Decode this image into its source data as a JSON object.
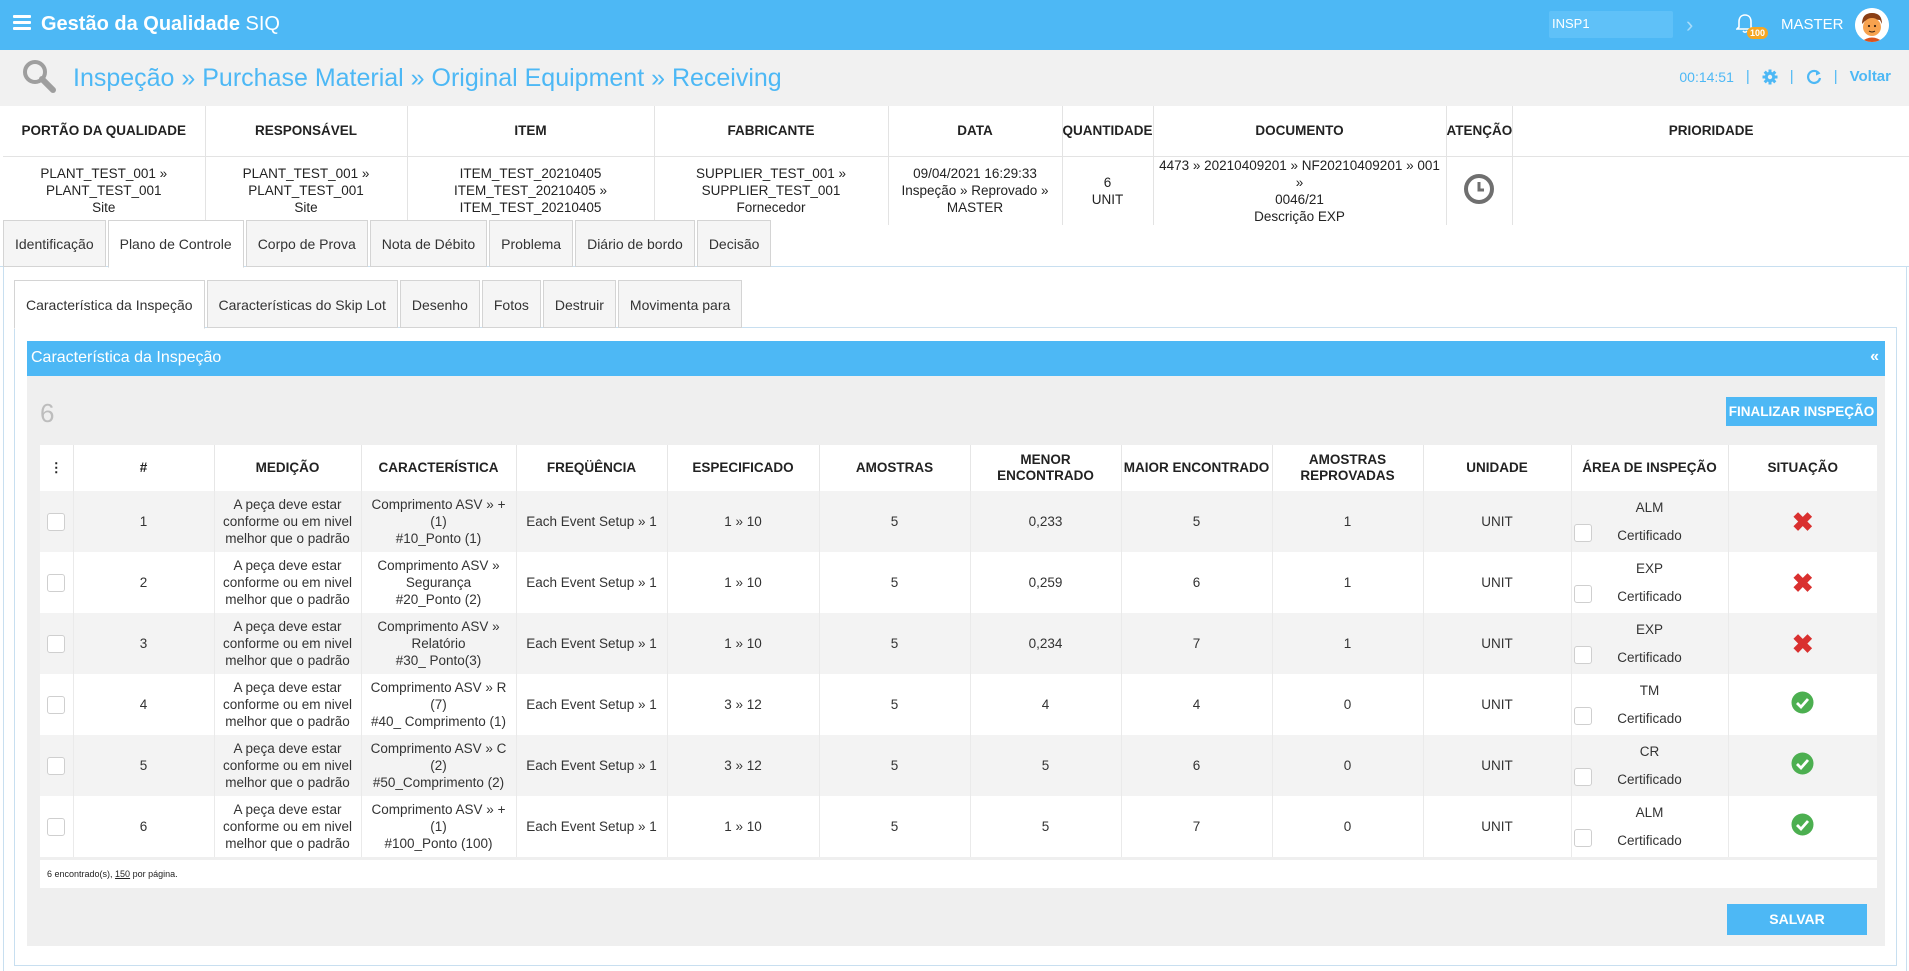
{
  "app": {
    "title_bold": "Gestão da Qualidade",
    "title_suffix": "SIQ"
  },
  "topbar": {
    "inspection_code": "INSP1",
    "notifications_count": "100",
    "user_name": "MASTER"
  },
  "breadcrumb": {
    "text": "Inspeção » Purchase Material » Original Equipment » Receiving",
    "timer": "00:14:51",
    "back_label": "Voltar"
  },
  "header_table": {
    "columns": [
      "PORTÃO DA QUALIDADE",
      "RESPONSÁVEL",
      "ITEM",
      "FABRICANTE",
      "DATA",
      "QUANTIDADE",
      "DOCUMENTO",
      "ATENÇÃO",
      "PRIORIDADE"
    ],
    "values": {
      "portao": [
        "PLANT_TEST_001 »",
        "PLANT_TEST_001",
        "Site"
      ],
      "responsavel": [
        "PLANT_TEST_001 »",
        "PLANT_TEST_001",
        "Site"
      ],
      "item": [
        "ITEM_TEST_20210405",
        "ITEM_TEST_20210405 »",
        "ITEM_TEST_20210405"
      ],
      "fabricante": [
        "SUPPLIER_TEST_001 »",
        "SUPPLIER_TEST_001",
        "Fornecedor"
      ],
      "data": [
        "09/04/2021 16:29:33",
        "Inspeção » Reprovado »",
        "MASTER"
      ],
      "quantidade": [
        "6",
        "UNIT"
      ],
      "documento": [
        "4473 » 20210409201 » NF20210409201 » 001 »",
        "0046/21",
        "Descrição EXP"
      ],
      "atencao_icon": "clock-icon",
      "prioridade": ""
    }
  },
  "tabs_main": [
    "Identificação",
    "Plano de Controle",
    "Corpo de Prova",
    "Nota de Débito",
    "Problema",
    "Diário de bordo",
    "Decisão"
  ],
  "tabs_main_active": 1,
  "tabs_sub": [
    "Característica da Inspeção",
    "Características do Skip Lot",
    "Desenho",
    "Fotos",
    "Destruir",
    "Movimenta para"
  ],
  "tabs_sub_active": 0,
  "panel": {
    "title": "Característica da Inspeção",
    "collapse_label": "«",
    "count": "6",
    "finalize_label": "FINALIZAR INSPEÇÃO",
    "save_label": "SALVAR"
  },
  "grid": {
    "menu_header": "⋮",
    "headers": [
      "#",
      "MEDIÇÃO",
      "CARACTERÍSTICA",
      "FREQÜÊNCIA",
      "ESPECIFICADO",
      "AMOSTRAS",
      "MENOR ENCONTRADO",
      "MAIOR ENCONTRADO",
      "AMOSTRAS REPROVADAS",
      "UNIDADE",
      "ÁREA DE INSPEÇÃO",
      "SITUAÇÃO"
    ],
    "rows": [
      {
        "num": "1",
        "medicao": [
          "A peça deve estar",
          "conforme ou em nivel",
          "melhor que o padrão"
        ],
        "caracteristica": [
          "Comprimento ASV » +",
          "(1)",
          "#10_Ponto (1)"
        ],
        "frequencia": "Each Event Setup » 1",
        "especificado": "1 » 10",
        "amostras": "5",
        "menor": "0,233",
        "maior": "5",
        "reprovadas": "1",
        "unidade": "UNIT",
        "area": "ALM",
        "area_label": "Certificado",
        "status": "reprovado"
      },
      {
        "num": "2",
        "medicao": [
          "A peça deve estar",
          "conforme ou em nivel",
          "melhor que o padrão"
        ],
        "caracteristica": [
          "Comprimento ASV »",
          "Segurança",
          "#20_Ponto (2)"
        ],
        "frequencia": "Each Event Setup » 1",
        "especificado": "1 » 10",
        "amostras": "5",
        "menor": "0,259",
        "maior": "6",
        "reprovadas": "1",
        "unidade": "UNIT",
        "area": "EXP",
        "area_label": "Certificado",
        "status": "reprovado"
      },
      {
        "num": "3",
        "medicao": [
          "A peça deve estar",
          "conforme ou em nivel",
          "melhor que o padrão"
        ],
        "caracteristica": [
          "Comprimento ASV »",
          "Relatório",
          "#30_ Ponto(3)"
        ],
        "frequencia": "Each Event Setup » 1",
        "especificado": "1 » 10",
        "amostras": "5",
        "menor": "0,234",
        "maior": "7",
        "reprovadas": "1",
        "unidade": "UNIT",
        "area": "EXP",
        "area_label": "Certificado",
        "status": "reprovado"
      },
      {
        "num": "4",
        "medicao": [
          "A peça deve estar",
          "conforme ou em nivel",
          "melhor que o padrão"
        ],
        "caracteristica": [
          "Comprimento ASV » R",
          "(7)",
          "#40_ Comprimento (1)"
        ],
        "frequencia": "Each Event Setup » 1",
        "especificado": "3 » 12",
        "amostras": "5",
        "menor": "4",
        "maior": "4",
        "reprovadas": "0",
        "unidade": "UNIT",
        "area": "TM",
        "area_label": "Certificado",
        "status": "aprovado"
      },
      {
        "num": "5",
        "medicao": [
          "A peça deve estar",
          "conforme ou em nivel",
          "melhor que o padrão"
        ],
        "caracteristica": [
          "Comprimento ASV » C",
          "(2)",
          "#50_Comprimento (2)"
        ],
        "frequencia": "Each Event Setup » 1",
        "especificado": "3 » 12",
        "amostras": "5",
        "menor": "5",
        "maior": "6",
        "reprovadas": "0",
        "unidade": "UNIT",
        "area": "CR",
        "area_label": "Certificado",
        "status": "aprovado"
      },
      {
        "num": "6",
        "medicao": [
          "A peça deve estar",
          "conforme ou em nivel",
          "melhor que o padrão"
        ],
        "caracteristica": [
          "Comprimento ASV » +",
          "(1)",
          "#100_Ponto (100)"
        ],
        "frequencia": "Each Event Setup » 1",
        "especificado": "1 » 10",
        "amostras": "5",
        "menor": "5",
        "maior": "7",
        "reprovadas": "0",
        "unidade": "UNIT",
        "area": "ALM",
        "area_label": "Certificado",
        "status": "aprovado"
      }
    ],
    "footer_prefix": "6 encontrado(s), ",
    "footer_per_page": "150",
    "footer_suffix": " por página."
  },
  "colors": {
    "accent": "#4db8f5",
    "reject": "#d9302f",
    "approve": "#4caf50"
  }
}
